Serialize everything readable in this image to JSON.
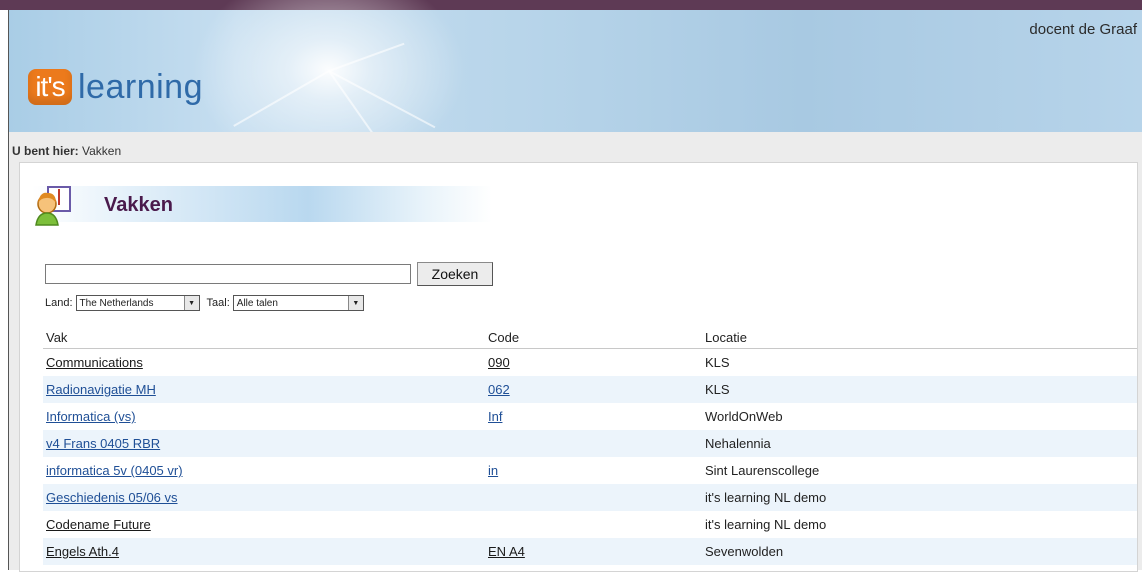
{
  "header": {
    "user_name": "docent de Graaf",
    "logo_badge": "it's",
    "logo_word": "learning"
  },
  "breadcrumb": {
    "prefix": "U bent hier:",
    "current": "Vakken"
  },
  "page": {
    "title": "Vakken"
  },
  "search": {
    "button_label": "Zoeken",
    "value": ""
  },
  "filters": {
    "land_label": "Land:",
    "land_value": "The Netherlands",
    "taal_label": "Taal:",
    "taal_value": "Alle talen"
  },
  "table": {
    "columns": [
      "Vak",
      "Code",
      "Locatie"
    ],
    "rows": [
      {
        "vak": "Communications",
        "code": "090",
        "locatie": "KLS",
        "link_color": "dark"
      },
      {
        "vak": "Radionavigatie MH",
        "code": "062",
        "locatie": "KLS",
        "link_color": "blue"
      },
      {
        "vak": "Informatica (vs)",
        "code": "Inf",
        "locatie": "WorldOnWeb",
        "link_color": "blue"
      },
      {
        "vak": "v4 Frans 0405 RBR",
        "code": "",
        "locatie": "Nehalennia",
        "link_color": "blue"
      },
      {
        "vak": "informatica 5v (0405 vr)",
        "code": "in",
        "locatie": "Sint Laurenscollege",
        "link_color": "blue"
      },
      {
        "vak": "Geschiedenis 05/06 vs",
        "code": "",
        "locatie": "it's learning NL demo",
        "link_color": "blue"
      },
      {
        "vak": "Codename Future",
        "code": "",
        "locatie": "it's learning NL demo",
        "link_color": "dark"
      },
      {
        "vak": "Engels Ath.4",
        "code": "EN A4",
        "locatie": "Sevenwolden",
        "link_color": "dark"
      }
    ]
  },
  "colors": {
    "topbar": "#5e3a55",
    "title": "#4a1a4c",
    "logo_orange": "#ec7a1c",
    "logo_blue": "#2f6aa8",
    "link_blue": "#1f4f96",
    "alt_row": "#ecf4fb"
  }
}
